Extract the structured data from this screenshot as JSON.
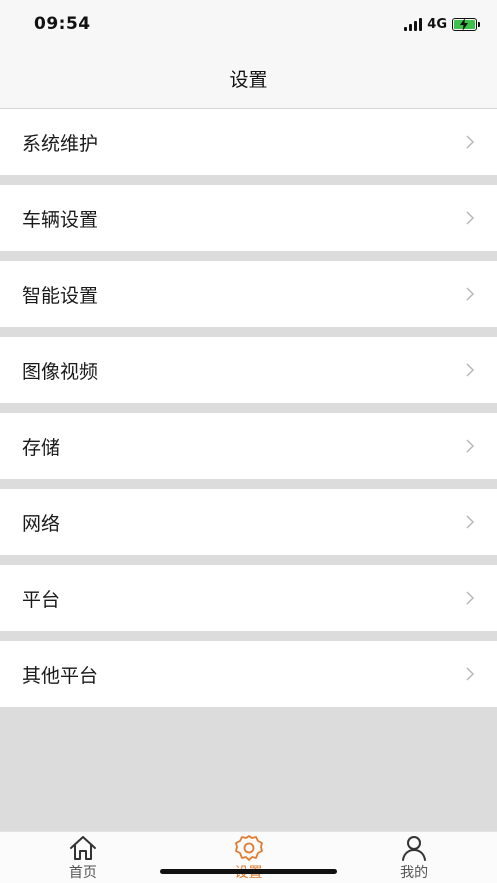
{
  "status": {
    "time": "09:54",
    "network": "4G",
    "battery_color": "#3cc24a"
  },
  "header": {
    "title": "设置"
  },
  "menu": [
    {
      "label": "系统维护",
      "icon": "chevron-right-icon"
    },
    {
      "label": "车辆设置",
      "icon": "chevron-right-icon"
    },
    {
      "label": "智能设置",
      "icon": "chevron-right-icon"
    },
    {
      "label": "图像视频",
      "icon": "chevron-right-icon"
    },
    {
      "label": "存储",
      "icon": "chevron-right-icon"
    },
    {
      "label": "网络",
      "icon": "chevron-right-icon"
    },
    {
      "label": "平台",
      "icon": "chevron-right-icon"
    },
    {
      "label": "其他平台",
      "icon": "chevron-right-icon"
    }
  ],
  "tabs": [
    {
      "label": "首页",
      "icon": "home-icon",
      "active": false
    },
    {
      "label": "设置",
      "icon": "gear-icon",
      "active": true
    },
    {
      "label": "我的",
      "icon": "user-icon",
      "active": false
    }
  ],
  "colors": {
    "accent": "#e07b2f",
    "background": "#dcdcdc",
    "chevron": "#b5b5b5"
  }
}
